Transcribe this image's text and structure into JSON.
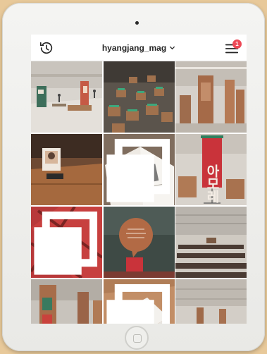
{
  "header": {
    "username": "hyangjang_mag",
    "notification_count": "1"
  },
  "icons": {
    "history": "history-icon",
    "dropdown": "chevron-down-icon",
    "menu": "menu-icon",
    "multi": "multiple-photos-icon"
  },
  "colors": {
    "badge": "#ed4956",
    "background": "#e8c99a",
    "device": "#f1f1ee"
  },
  "grid": {
    "posts": [
      {
        "subject": "exhibition-hall"
      },
      {
        "subject": "green-topped-boxes"
      },
      {
        "subject": "pillar-display"
      },
      {
        "subject": "portrait-on-table",
        "multiple": false
      },
      {
        "subject": "open-magazine",
        "multiple": true
      },
      {
        "subject": "korean-banner",
        "banner_text": "아모레"
      },
      {
        "subject": "red-platform",
        "multiple": true
      },
      {
        "subject": "speech-bubble-sign"
      },
      {
        "subject": "seating-rows"
      },
      {
        "subject": "tall-pillars"
      },
      {
        "subject": "book-stack",
        "multiple": true
      },
      {
        "subject": "hall-interior"
      }
    ]
  }
}
